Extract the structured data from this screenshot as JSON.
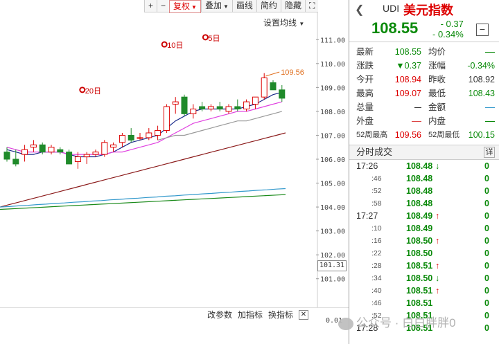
{
  "toolbar": {
    "plus": "+",
    "minus": "−",
    "adjust": "复权",
    "overlay": "叠加",
    "draw": "画线",
    "simple": "简约",
    "hide": "隐藏",
    "expand": "⛶"
  },
  "ma_setting": "设置均线",
  "y_axis": [
    "111.00",
    "110.00",
    "109.00",
    "108.00",
    "107.00",
    "106.00",
    "105.00",
    "104.00",
    "103.00",
    "102.00",
    "101.00"
  ],
  "current_price_tag": "101.31",
  "high_marker": "109.56",
  "period_markers": [
    {
      "label": "20日"
    },
    {
      "label": "10日"
    },
    {
      "label": "5日"
    }
  ],
  "indicator_bar": {
    "params": "改参数",
    "add": "加指标",
    "switch": "换指标",
    "close": "✕"
  },
  "volume_tick": "0.01",
  "chart_data": {
    "type": "candlestick",
    "ylim": [
      100.5,
      111.5
    ],
    "candles": [
      {
        "o": 106.3,
        "h": 106.5,
        "l": 105.9,
        "c": 106.0
      },
      {
        "o": 106.0,
        "h": 106.4,
        "l": 105.7,
        "c": 105.8
      },
      {
        "o": 106.2,
        "h": 106.6,
        "l": 105.9,
        "c": 106.4
      },
      {
        "o": 106.5,
        "h": 106.8,
        "l": 106.3,
        "c": 106.6
      },
      {
        "o": 106.6,
        "h": 106.7,
        "l": 106.2,
        "c": 106.3
      },
      {
        "o": 106.3,
        "h": 106.6,
        "l": 106.2,
        "c": 106.5
      },
      {
        "o": 106.4,
        "h": 106.5,
        "l": 106.2,
        "c": 106.3
      },
      {
        "o": 106.3,
        "h": 106.4,
        "l": 105.8,
        "c": 105.8
      },
      {
        "o": 105.9,
        "h": 106.3,
        "l": 105.6,
        "c": 106.1
      },
      {
        "o": 106.1,
        "h": 106.3,
        "l": 105.8,
        "c": 106.2
      },
      {
        "o": 106.2,
        "h": 106.4,
        "l": 106.1,
        "c": 106.3
      },
      {
        "o": 106.2,
        "h": 106.8,
        "l": 106.1,
        "c": 106.7
      },
      {
        "o": 106.5,
        "h": 106.7,
        "l": 106.3,
        "c": 106.6
      },
      {
        "o": 106.7,
        "h": 107.1,
        "l": 106.5,
        "c": 107.0
      },
      {
        "o": 107.0,
        "h": 107.3,
        "l": 106.7,
        "c": 106.8
      },
      {
        "o": 106.9,
        "h": 107.1,
        "l": 106.8,
        "c": 106.9
      },
      {
        "o": 106.9,
        "h": 107.3,
        "l": 106.8,
        "c": 107.1
      },
      {
        "o": 107.0,
        "h": 107.4,
        "l": 106.8,
        "c": 107.2
      },
      {
        "o": 107.2,
        "h": 108.3,
        "l": 107.1,
        "c": 108.2
      },
      {
        "o": 108.3,
        "h": 108.6,
        "l": 107.9,
        "c": 108.4
      },
      {
        "o": 108.6,
        "h": 108.7,
        "l": 107.8,
        "c": 107.9
      },
      {
        "o": 107.9,
        "h": 108.3,
        "l": 107.7,
        "c": 108.1
      },
      {
        "o": 108.2,
        "h": 108.4,
        "l": 108.0,
        "c": 108.1
      },
      {
        "o": 108.1,
        "h": 108.3,
        "l": 108.0,
        "c": 108.2
      },
      {
        "o": 108.2,
        "h": 108.4,
        "l": 108.0,
        "c": 108.1
      },
      {
        "o": 108.0,
        "h": 108.3,
        "l": 107.9,
        "c": 108.2
      },
      {
        "o": 108.2,
        "h": 108.5,
        "l": 108.0,
        "c": 108.1
      },
      {
        "o": 108.1,
        "h": 108.5,
        "l": 108.0,
        "c": 108.4
      },
      {
        "o": 108.3,
        "h": 108.6,
        "l": 108.1,
        "c": 108.6
      },
      {
        "o": 108.6,
        "h": 109.6,
        "l": 108.5,
        "c": 109.4
      },
      {
        "o": 109.2,
        "h": 109.3,
        "l": 108.9,
        "c": 108.9
      },
      {
        "o": 108.9,
        "h": 109.1,
        "l": 108.4,
        "c": 108.55
      }
    ],
    "ma_lines": [
      {
        "color": "#1a2a8a",
        "values": [
          106.4,
          106.3,
          106.2,
          106.2,
          106.3,
          106.3,
          106.3,
          106.2,
          106.1,
          106.1,
          106.1,
          106.2,
          106.3,
          106.5,
          106.7,
          106.8,
          106.9,
          107.0,
          107.3,
          107.6,
          107.8,
          108.0,
          108.1,
          108.1,
          108.1,
          108.1,
          108.1,
          108.2,
          108.3,
          108.5,
          108.7,
          108.8
        ]
      },
      {
        "color": "#e040e0",
        "values": [
          106.5,
          106.4,
          106.3,
          106.3,
          106.3,
          106.3,
          106.3,
          106.2,
          106.2,
          106.2,
          106.2,
          106.2,
          106.3,
          106.3,
          106.4,
          106.5,
          106.6,
          106.7,
          106.9,
          107.1,
          107.3,
          107.5,
          107.6,
          107.7,
          107.8,
          107.9,
          108.0,
          108.0,
          108.1,
          108.2,
          108.3,
          108.4
        ]
      },
      {
        "color": "#999999",
        "values": [
          null,
          null,
          null,
          null,
          null,
          null,
          null,
          null,
          null,
          null,
          null,
          null,
          null,
          null,
          null,
          null,
          null,
          106.8,
          106.9,
          107.0,
          107.0,
          107.1,
          107.2,
          107.3,
          107.4,
          107.5,
          107.6,
          107.6,
          107.7,
          107.8,
          107.9,
          108.0
        ]
      },
      {
        "color": "#8b1a1a",
        "values": [
          104.0,
          104.1,
          104.2,
          104.3,
          104.4,
          104.5,
          104.6,
          104.7,
          104.8,
          104.9,
          105.0,
          105.1,
          105.2,
          105.3,
          105.4,
          105.5,
          105.6,
          105.7,
          105.8,
          105.9,
          106.0,
          106.1,
          106.2,
          106.3,
          106.4,
          106.5,
          106.6,
          106.7,
          106.8,
          106.9,
          107.0,
          107.1
        ]
      },
      {
        "color": "#3399cc",
        "values": [
          104.0,
          104.02,
          104.05,
          104.07,
          104.1,
          104.12,
          104.15,
          104.17,
          104.2,
          104.22,
          104.25,
          104.27,
          104.3,
          104.32,
          104.35,
          104.37,
          104.4,
          104.42,
          104.45,
          104.47,
          104.5,
          104.52,
          104.55,
          104.57,
          104.6,
          104.62,
          104.65,
          104.67,
          104.7,
          104.72,
          104.75,
          104.77
        ]
      },
      {
        "color": "#1a8a1a",
        "values": [
          103.9,
          103.92,
          103.94,
          103.96,
          103.98,
          104.0,
          104.02,
          104.04,
          104.06,
          104.08,
          104.1,
          104.12,
          104.14,
          104.16,
          104.18,
          104.2,
          104.22,
          104.24,
          104.26,
          104.28,
          104.3,
          104.32,
          104.34,
          104.36,
          104.38,
          104.4,
          104.42,
          104.44,
          104.46,
          104.48,
          104.5,
          104.52
        ]
      }
    ]
  },
  "quote": {
    "nav_icon": "❮",
    "code": "UDI",
    "name": "美元指数",
    "price": "108.55",
    "change": "- 0.37",
    "change_pct": "- 0.34%",
    "collapse": "−"
  },
  "stats": [
    {
      "l1": "最新",
      "v1": "108.55",
      "c1": "green",
      "l2": "均价",
      "v2": "—",
      "c2": "green"
    },
    {
      "l1": "涨跌",
      "v1": "▼0.37",
      "c1": "green",
      "l2": "涨幅",
      "v2": "-0.34%",
      "c2": "green"
    },
    {
      "l1": "今开",
      "v1": "108.94",
      "c1": "red",
      "l2": "昨收",
      "v2": "108.92",
      "c2": "blk"
    },
    {
      "l1": "最高",
      "v1": "109.07",
      "c1": "red",
      "l2": "最低",
      "v2": "108.43",
      "c2": "green"
    },
    {
      "l1": "总量",
      "v1": "—",
      "c1": "blk",
      "l2": "金额",
      "v2": "—",
      "c2": "blue"
    },
    {
      "l1": "外盘",
      "v1": "—",
      "c1": "red",
      "l2": "内盘",
      "v2": "—",
      "c2": "green"
    },
    {
      "l1": "52周最高",
      "v1": "109.56",
      "c1": "red",
      "l2": "52周最低",
      "v2": "100.15",
      "c2": "green",
      "small": true
    }
  ],
  "trades_title": "分时成交",
  "trades_detail": "详",
  "trades": [
    {
      "time": "17:26",
      "sub": false,
      "price": "108.48",
      "dir": "dn",
      "vol": "0"
    },
    {
      "time": ":46",
      "sub": true,
      "price": "108.48",
      "dir": "",
      "vol": "0"
    },
    {
      "time": ":52",
      "sub": true,
      "price": "108.48",
      "dir": "",
      "vol": "0"
    },
    {
      "time": ":58",
      "sub": true,
      "price": "108.48",
      "dir": "",
      "vol": "0"
    },
    {
      "time": "17:27",
      "sub": false,
      "price": "108.49",
      "dir": "up",
      "vol": "0"
    },
    {
      "time": ":10",
      "sub": true,
      "price": "108.49",
      "dir": "",
      "vol": "0"
    },
    {
      "time": ":16",
      "sub": true,
      "price": "108.50",
      "dir": "up",
      "vol": "0"
    },
    {
      "time": ":22",
      "sub": true,
      "price": "108.50",
      "dir": "",
      "vol": "0"
    },
    {
      "time": ":28",
      "sub": true,
      "price": "108.51",
      "dir": "up",
      "vol": "0"
    },
    {
      "time": ":34",
      "sub": true,
      "price": "108.50",
      "dir": "dn",
      "vol": "0"
    },
    {
      "time": ":40",
      "sub": true,
      "price": "108.51",
      "dir": "up",
      "vol": "0"
    },
    {
      "time": ":46",
      "sub": true,
      "price": "108.51",
      "dir": "",
      "vol": "0"
    },
    {
      "time": ":52",
      "sub": true,
      "price": "108.51",
      "dir": "",
      "vol": "0"
    },
    {
      "time": "17:28",
      "sub": false,
      "price": "108.51",
      "dir": "",
      "vol": "0"
    }
  ],
  "watermark": "公众号 · 白白胖胖0"
}
